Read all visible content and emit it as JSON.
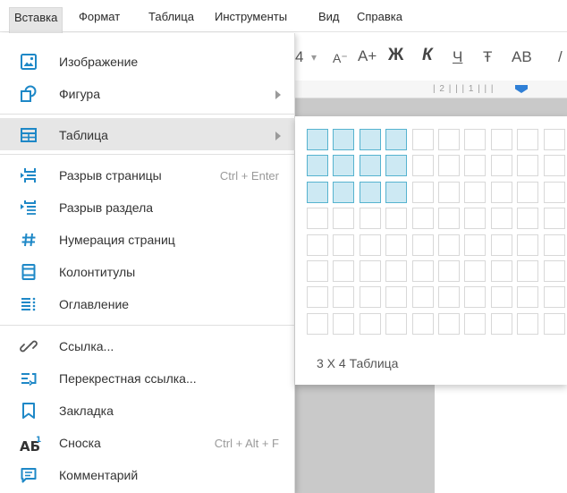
{
  "menubar": {
    "items": [
      {
        "label": "Вставка",
        "active": true
      },
      {
        "label": "Формат",
        "active": false
      },
      {
        "label": "Таблица",
        "active": false
      },
      {
        "label": "Инструменты",
        "active": false
      },
      {
        "label": "Вид",
        "active": false
      },
      {
        "label": "Справка",
        "active": false
      }
    ]
  },
  "toolbar": {
    "font_size": "4",
    "font_size_dropdown": "▾",
    "decrease_font": "A⁻",
    "increase_font": "A+",
    "bold": "Ж",
    "italic": "К",
    "underline": "Ч",
    "strikethrough": "Ŧ",
    "caps": "АВ",
    "more": "/"
  },
  "ruler": {
    "text": "| 2 | | | 1 | | |"
  },
  "insert_menu": {
    "items": [
      {
        "label": "Изображение",
        "icon": "image-icon"
      },
      {
        "label": "Фигура",
        "icon": "shape-icon",
        "submenu": true
      },
      {
        "label": "Таблица",
        "icon": "table-icon",
        "submenu": true,
        "highlighted": true
      },
      {
        "label": "Разрыв страницы",
        "icon": "page-break-icon",
        "shortcut": "Ctrl + Enter"
      },
      {
        "label": "Разрыв раздела",
        "icon": "section-break-icon"
      },
      {
        "label": "Нумерация страниц",
        "icon": "page-numbering-icon"
      },
      {
        "label": "Колонтитулы",
        "icon": "header-footer-icon"
      },
      {
        "label": "Оглавление",
        "icon": "table-of-contents-icon"
      },
      {
        "label": "Ссылка...",
        "icon": "link-icon"
      },
      {
        "label": "Перекрестная ссылка...",
        "icon": "cross-reference-icon"
      },
      {
        "label": "Закладка",
        "icon": "bookmark-icon"
      },
      {
        "label": "Сноска",
        "icon": "footnote-icon",
        "shortcut": "Ctrl + Alt + F"
      },
      {
        "label": "Комментарий",
        "icon": "comment-icon"
      }
    ]
  },
  "table_picker": {
    "columns": 10,
    "rows": 8,
    "selected_columns": 4,
    "selected_rows": 3,
    "label": "3 X 4 Таблица"
  },
  "colors": {
    "accent": "#1e88c7",
    "selected_cell": "#cde9f3",
    "selected_border": "#56b3cf",
    "hover": "#e6e6e6"
  }
}
